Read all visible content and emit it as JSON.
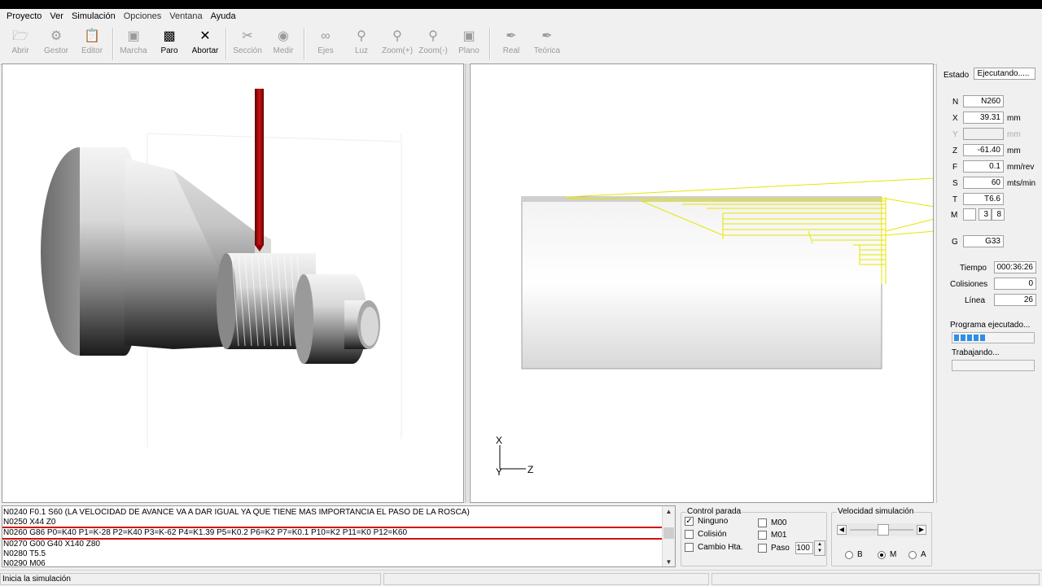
{
  "menu": [
    "Proyecto",
    "Ver",
    "Simulación",
    "Opciones",
    "Ventana",
    "Ayuda"
  ],
  "toolbar": {
    "abrir": "Abrir",
    "gestor": "Gestor",
    "editor": "Editor",
    "marcha": "Marcha",
    "paro": "Paro",
    "abortar": "Abortar",
    "seccion": "Sección",
    "medir": "Medir",
    "ejes": "Ejes",
    "luz": "Luz",
    "zoom_in": "Zoom(+)",
    "zoom_out": "Zoom(-)",
    "plano": "Plano",
    "real": "Real",
    "teorica": "Teórica"
  },
  "view2d": {
    "axis_x": "X",
    "axis_y": "Y",
    "axis_z": "Z"
  },
  "panel": {
    "estado_label": "Estado",
    "estado_value": "Ejecutando.....",
    "n_label": "N",
    "n_value": "N260",
    "x_label": "X",
    "x_value": "39.31",
    "x_unit": "mm",
    "y_label": "Y",
    "y_value": "",
    "y_unit": "mm",
    "z_label": "Z",
    "z_value": "-61.40",
    "z_unit": "mm",
    "f_label": "F",
    "f_value": "0.1",
    "f_unit": "mm/rev",
    "s_label": "S",
    "s_value": "60",
    "s_unit": "mts/min",
    "t_label": "T",
    "t_value": "T6.6",
    "m_label": "M",
    "m_value1": "",
    "m_value2": "3",
    "m_value3": "8",
    "g_label": "G",
    "g_value": "G33",
    "tiempo_label": "Tiempo",
    "tiempo_value": "000:36:26",
    "colisiones_label": "Colisiones",
    "colisiones_value": "0",
    "linea_label": "Línea",
    "linea_value": "26",
    "programa_label": "Programa ejecutado...",
    "programa_progress": 0.45,
    "trabajando_label": "Trabajando...",
    "trabajando_progress": 0
  },
  "code_lines": [
    "N0240 F0.1 S60 (LA VELOCIDAD DE AVANCE VA A DAR IGUAL YA QUE TIENE MAS IMPORTANCIA EL PASO DE LA ROSCA)",
    "N0250 X44 Z0",
    "N0260 G86 P0=K40 P1=K-28 P2=K40 P3=K-62 P4=K1.39 P5=K0.2 P6=K2 P7=K0.1 P10=K2 P11=K0 P12=K60",
    "N0270 G00 G40 X140 Z80",
    "N0280 T5.5",
    "N0290 M06"
  ],
  "control_parada": {
    "title": "Control parada",
    "ninguno": "Ninguno",
    "colision": "Colisión",
    "cambio": "Cambio Hta.",
    "m00": "M00",
    "m01": "M01",
    "paso": "Paso",
    "paso_value": "100"
  },
  "velocidad": {
    "title": "Velocidad simulación",
    "b": "B",
    "m": "M",
    "a": "A"
  },
  "status": {
    "text": "Inicia la simulación"
  }
}
